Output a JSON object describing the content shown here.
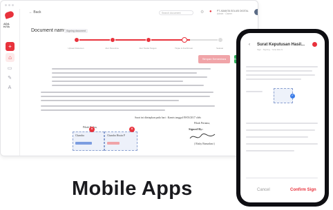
{
  "brand": {
    "accent": "#e8323c",
    "success": "#2dae5a"
  },
  "desktop": {
    "back_label": "Back",
    "search_placeholder": "Search document",
    "user_name": "PT. ADAKITA SOLUSI DIGITAL",
    "user_role": "Admin · Owner",
    "doc_title": "Document name",
    "doc_badge": "Signing document",
    "steps": [
      "Upload Dokumen",
      "Atur Penerima",
      "Atur Tanda Tangan",
      "Tinjau & Konfirmasi",
      "Selesai"
    ],
    "simpan_label": "Simpan Sementara",
    "next_label": "Berikutnya",
    "paper_place_date": "Surat ini ditetapkan pada hari : Kamis tanggal 09/03/2017 oleh:",
    "left_sign_title": "Pihak Kedua,",
    "left_sign_name": "Chandra",
    "left_sign_name2": "Chandra Husin P",
    "right_sign_title": "Pihak Pertama,",
    "signed_by": "Signed By:",
    "right_sign_name": "( Rizky Ramadani )",
    "rail_icons": [
      "home-icon",
      "document-icon",
      "signature-icon",
      "translate-icon"
    ]
  },
  "phone": {
    "title": "Surat Keputusan Hasil...",
    "subtitle": "Sign · Signing · Yana Eka G.",
    "cancel_label": "Cancel",
    "confirm_label": "Confirm Sign"
  },
  "caption": "Mobile Apps"
}
